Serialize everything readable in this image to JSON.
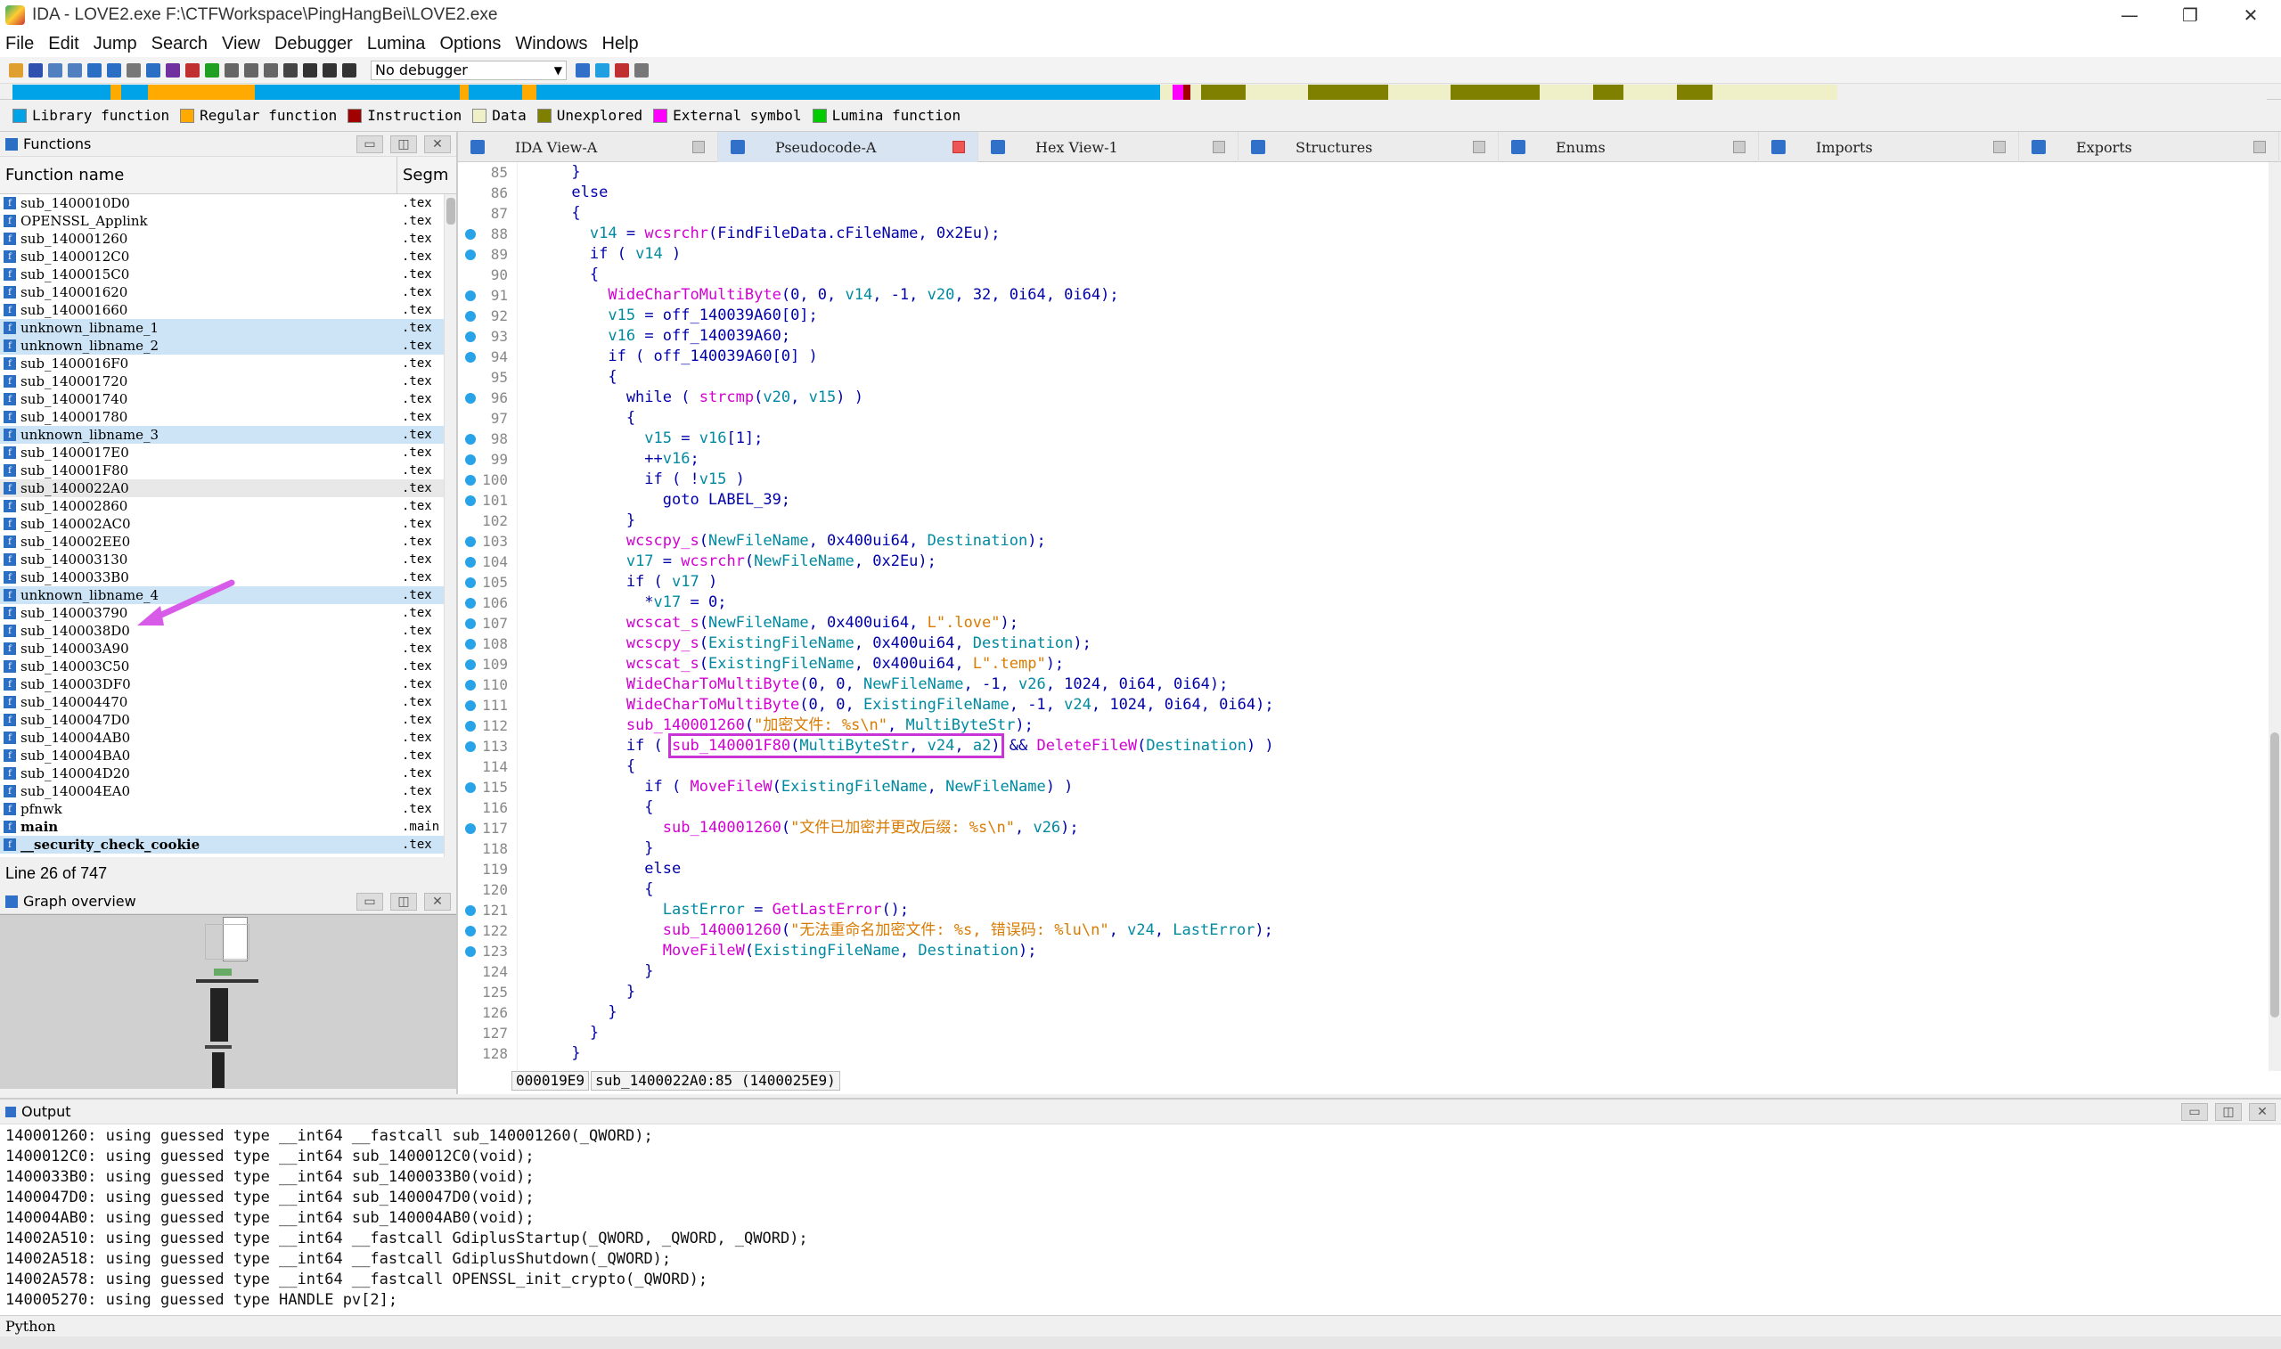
{
  "window": {
    "title": "IDA - LOVE2.exe F:\\CTFWorkspace\\PingHangBei\\LOVE2.exe",
    "controls": [
      "—",
      "❐",
      "✕"
    ]
  },
  "menu": [
    "File",
    "Edit",
    "Jump",
    "Search",
    "View",
    "Debugger",
    "Lumina",
    "Options",
    "Windows",
    "Help"
  ],
  "toolbar": {
    "debugger": "No debugger"
  },
  "legend": [
    {
      "label": "Library function",
      "color": "#00a2e8"
    },
    {
      "label": "Regular function",
      "color": "#ffaa00"
    },
    {
      "label": "Instruction",
      "color": "#a00000"
    },
    {
      "label": "Data",
      "color": "#f0f0c8"
    },
    {
      "label": "Unexplored",
      "color": "#808000"
    },
    {
      "label": "External symbol",
      "color": "#ff00ff"
    },
    {
      "label": "Lumina function",
      "color": "#00cc00"
    }
  ],
  "functions": {
    "panel_title": "Functions",
    "col_name": "Function name",
    "col_seg": "Segm",
    "rows": [
      {
        "name": "sub_1400010D0",
        "seg": ".tex",
        "lib": false
      },
      {
        "name": "OPENSSL_Applink",
        "seg": ".tex",
        "lib": false
      },
      {
        "name": "sub_140001260",
        "seg": ".tex",
        "lib": false
      },
      {
        "name": "sub_1400012C0",
        "seg": ".tex",
        "lib": false
      },
      {
        "name": "sub_1400015C0",
        "seg": ".tex",
        "lib": false
      },
      {
        "name": "sub_140001620",
        "seg": ".tex",
        "lib": false
      },
      {
        "name": "sub_140001660",
        "seg": ".tex",
        "lib": false
      },
      {
        "name": "unknown_libname_1",
        "seg": ".tex",
        "lib": true
      },
      {
        "name": "unknown_libname_2",
        "seg": ".tex",
        "lib": true
      },
      {
        "name": "sub_1400016F0",
        "seg": ".tex",
        "lib": false
      },
      {
        "name": "sub_140001720",
        "seg": ".tex",
        "lib": false
      },
      {
        "name": "sub_140001740",
        "seg": ".tex",
        "lib": false
      },
      {
        "name": "sub_140001780",
        "seg": ".tex",
        "lib": false
      },
      {
        "name": "unknown_libname_3",
        "seg": ".tex",
        "lib": true
      },
      {
        "name": "sub_1400017E0",
        "seg": ".tex",
        "lib": false
      },
      {
        "name": "sub_140001F80",
        "seg": ".tex",
        "lib": false
      },
      {
        "name": "sub_1400022A0",
        "seg": ".tex",
        "lib": false,
        "sel": true
      },
      {
        "name": "sub_140002860",
        "seg": ".tex",
        "lib": false
      },
      {
        "name": "sub_140002AC0",
        "seg": ".tex",
        "lib": false
      },
      {
        "name": "sub_140002EE0",
        "seg": ".tex",
        "lib": false
      },
      {
        "name": "sub_140003130",
        "seg": ".tex",
        "lib": false
      },
      {
        "name": "sub_1400033B0",
        "seg": ".tex",
        "lib": false
      },
      {
        "name": "unknown_libname_4",
        "seg": ".tex",
        "lib": true
      },
      {
        "name": "sub_140003790",
        "seg": ".tex",
        "lib": false
      },
      {
        "name": "sub_1400038D0",
        "seg": ".tex",
        "lib": false
      },
      {
        "name": "sub_140003A90",
        "seg": ".tex",
        "lib": false
      },
      {
        "name": "sub_140003C50",
        "seg": ".tex",
        "lib": false
      },
      {
        "name": "sub_140003DF0",
        "seg": ".tex",
        "lib": false
      },
      {
        "name": "sub_140004470",
        "seg": ".tex",
        "lib": false
      },
      {
        "name": "sub_1400047D0",
        "seg": ".tex",
        "lib": false
      },
      {
        "name": "sub_140004AB0",
        "seg": ".tex",
        "lib": false
      },
      {
        "name": "sub_140004BA0",
        "seg": ".tex",
        "lib": false
      },
      {
        "name": "sub_140004D20",
        "seg": ".tex",
        "lib": false
      },
      {
        "name": "sub_140004EA0",
        "seg": ".tex",
        "lib": false
      },
      {
        "name": "pfnwk",
        "seg": ".tex",
        "lib": false
      },
      {
        "name": "main",
        "seg": ".main",
        "lib": false,
        "bold": true
      },
      {
        "name": "__security_check_cookie",
        "seg": ".tex",
        "lib": true,
        "bold": true
      }
    ],
    "status": "Line 26 of 747"
  },
  "graph": {
    "title": "Graph overview"
  },
  "tabs": [
    {
      "label": "IDA View-A",
      "active": false
    },
    {
      "label": "Pseudocode-A",
      "active": true
    },
    {
      "label": "Hex View-1",
      "active": false
    },
    {
      "label": "Structures",
      "active": false
    },
    {
      "label": "Enums",
      "active": false
    },
    {
      "label": "Imports",
      "active": false
    },
    {
      "label": "Exports",
      "active": false
    }
  ],
  "code": {
    "lines": [
      {
        "n": "85",
        "bp": false,
        "t": "      }"
      },
      {
        "n": "86",
        "bp": false,
        "t": "      else"
      },
      {
        "n": "87",
        "bp": false,
        "t": "      {"
      },
      {
        "n": "88",
        "bp": true,
        "t": "        v14 = wcsrchr(FindFileData.cFileName, 0x2Eu);"
      },
      {
        "n": "89",
        "bp": true,
        "t": "        if ( v14 )"
      },
      {
        "n": "90",
        "bp": false,
        "t": "        {"
      },
      {
        "n": "91",
        "bp": true,
        "t": "          WideCharToMultiByte(0, 0, v14, -1, v20, 32, 0i64, 0i64);"
      },
      {
        "n": "92",
        "bp": true,
        "t": "          v15 = off_140039A60[0];"
      },
      {
        "n": "93",
        "bp": true,
        "t": "          v16 = off_140039A60;"
      },
      {
        "n": "94",
        "bp": true,
        "t": "          if ( off_140039A60[0] )"
      },
      {
        "n": "95",
        "bp": false,
        "t": "          {"
      },
      {
        "n": "96",
        "bp": true,
        "t": "            while ( strcmp(v20, v15) )"
      },
      {
        "n": "97",
        "bp": false,
        "t": "            {"
      },
      {
        "n": "98",
        "bp": true,
        "t": "              v15 = v16[1];"
      },
      {
        "n": "99",
        "bp": true,
        "t": "              ++v16;"
      },
      {
        "n": "100",
        "bp": true,
        "t": "              if ( !v15 )"
      },
      {
        "n": "101",
        "bp": true,
        "t": "                goto LABEL_39;"
      },
      {
        "n": "102",
        "bp": false,
        "t": "            }"
      },
      {
        "n": "103",
        "bp": true,
        "t": "            wcscpy_s(NewFileName, 0x400ui64, Destination);"
      },
      {
        "n": "104",
        "bp": true,
        "t": "            v17 = wcsrchr(NewFileName, 0x2Eu);"
      },
      {
        "n": "105",
        "bp": true,
        "t": "            if ( v17 )"
      },
      {
        "n": "106",
        "bp": true,
        "t": "              *v17 = 0;"
      },
      {
        "n": "107",
        "bp": true,
        "t": "            wcscat_s(NewFileName, 0x400ui64, L\".love\");"
      },
      {
        "n": "108",
        "bp": true,
        "t": "            wcscpy_s(ExistingFileName, 0x400ui64, Destination);"
      },
      {
        "n": "109",
        "bp": true,
        "t": "            wcscat_s(ExistingFileName, 0x400ui64, L\".temp\");"
      },
      {
        "n": "110",
        "bp": true,
        "t": "            WideCharToMultiByte(0, 0, NewFileName, -1, v26, 1024, 0i64, 0i64);"
      },
      {
        "n": "111",
        "bp": true,
        "t": "            WideCharToMultiByte(0, 0, ExistingFileName, -1, v24, 1024, 0i64, 0i64);"
      },
      {
        "n": "112",
        "bp": true,
        "t": "            sub_140001260(\"加密文件: %s\\n\", MultiByteStr);"
      },
      {
        "n": "113",
        "bp": true,
        "t": "            if ( sub_140001F80(MultiByteStr, v24, a2) && DeleteFileW(Destination) )",
        "hl": true
      },
      {
        "n": "114",
        "bp": false,
        "t": "            {"
      },
      {
        "n": "115",
        "bp": true,
        "t": "              if ( MoveFileW(ExistingFileName, NewFileName) )"
      },
      {
        "n": "116",
        "bp": false,
        "t": "              {"
      },
      {
        "n": "117",
        "bp": true,
        "t": "                sub_140001260(\"文件已加密并更改后缀: %s\\n\", v26);"
      },
      {
        "n": "118",
        "bp": false,
        "t": "              }"
      },
      {
        "n": "119",
        "bp": false,
        "t": "              else"
      },
      {
        "n": "120",
        "bp": false,
        "t": "              {"
      },
      {
        "n": "121",
        "bp": true,
        "t": "                LastError = GetLastError();"
      },
      {
        "n": "122",
        "bp": true,
        "t": "                sub_140001260(\"无法重命名加密文件: %s, 错误码: %lu\\n\", v24, LastError);"
      },
      {
        "n": "123",
        "bp": true,
        "t": "                MoveFileW(ExistingFileName, Destination);"
      },
      {
        "n": "124",
        "bp": false,
        "t": "              }"
      },
      {
        "n": "125",
        "bp": false,
        "t": "            }"
      },
      {
        "n": "126",
        "bp": false,
        "t": "          }"
      },
      {
        "n": "127",
        "bp": false,
        "t": "        }"
      },
      {
        "n": "128",
        "bp": false,
        "t": "      }"
      }
    ],
    "status_offset": "000019E9",
    "status_loc": "sub_1400022A0:85 (1400025E9)"
  },
  "output": {
    "title": "Output",
    "lines": [
      "140001260: using guessed type __int64 __fastcall sub_140001260(_QWORD);",
      "1400012C0: using guessed type __int64 sub_1400012C0(void);",
      "1400033B0: using guessed type __int64 sub_1400033B0(void);",
      "1400047D0: using guessed type __int64 sub_1400047D0(void);",
      "140004AB0: using guessed type __int64 sub_140004AB0(void);",
      "14002A510: using guessed type __int64 __fastcall GdiplusStartup(_QWORD, _QWORD, _QWORD);",
      "14002A518: using guessed type __int64 __fastcall GdiplusShutdown(_QWORD);",
      "14002A578: using guessed type __int64 __fastcall OPENSSL_init_crypto(_QWORD);",
      "140005270: using guessed type HANDLE pv[2];"
    ],
    "input_label": "Python"
  }
}
